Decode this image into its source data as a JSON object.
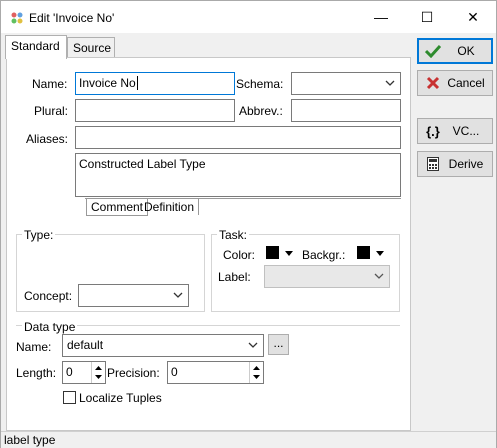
{
  "window": {
    "title": "Edit 'Invoice No'",
    "minimize_label": "—",
    "maximize_label": "☐",
    "close_label": "✕"
  },
  "tabs": [
    {
      "label": "Standard",
      "active": true
    },
    {
      "label": "Source",
      "active": false
    }
  ],
  "form": {
    "name_label": "Name:",
    "name_value": "Invoice No",
    "schema_label": "Schema:",
    "schema_value": "",
    "plural_label": "Plural:",
    "plural_value": "",
    "abbrev_label": "Abbrev.:",
    "abbrev_value": "",
    "aliases_label": "Aliases:",
    "aliases_value": "",
    "comment_text": "Constructed Label Type",
    "subtabs": [
      "Comment",
      "Definition"
    ]
  },
  "type_group": {
    "title": "Type:",
    "concept_label": "Concept:",
    "concept_value": ""
  },
  "task_group": {
    "title": "Task:",
    "color_label": "Color:",
    "backgr_label": "Backgr.:",
    "label_label": "Label:",
    "label_value": "",
    "color": "#000000",
    "backgr": "#000000"
  },
  "datatype_group": {
    "title": "Data type",
    "name_label": "Name:",
    "name_value": "default",
    "browse_label": "...",
    "length_label": "Length:",
    "length_value": "0",
    "precision_label": "Precision:",
    "precision_value": "0",
    "localize_label": "Localize Tuples",
    "localize_checked": false
  },
  "buttons": {
    "ok": "OK",
    "cancel": "Cancel",
    "vc": "VC...",
    "derive": "Derive"
  },
  "status": {
    "text": "label type"
  }
}
